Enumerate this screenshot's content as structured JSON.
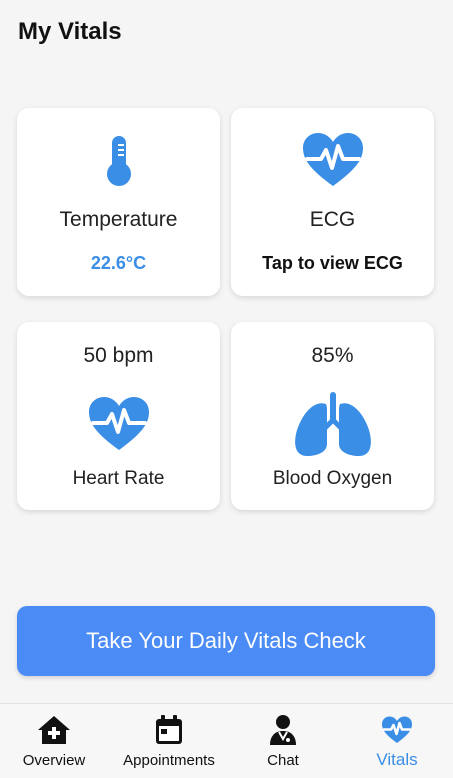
{
  "header": {
    "title": "My Vitals"
  },
  "cards": {
    "temperature": {
      "label": "Temperature",
      "value": "22.6°C",
      "icon": "thermometer-icon"
    },
    "ecg": {
      "label": "ECG",
      "value": "Tap to view ECG",
      "icon": "heart-pulse-icon"
    },
    "heart_rate": {
      "value": "50 bpm",
      "label": "Heart Rate",
      "icon": "heart-pulse-icon"
    },
    "blood_oxygen": {
      "value": "85%",
      "label": "Blood Oxygen",
      "icon": "lungs-icon"
    }
  },
  "cta": {
    "label": "Take Your Daily Vitals Check"
  },
  "nav": {
    "items": [
      {
        "label": "Overview",
        "icon": "home-plus-icon"
      },
      {
        "label": "Appointments",
        "icon": "calendar-icon"
      },
      {
        "label": "Chat",
        "icon": "doctor-icon"
      },
      {
        "label": "Vitals",
        "icon": "heart-pulse-icon",
        "active": true
      }
    ]
  },
  "colors": {
    "accent": "#4a8bf5",
    "icon_blue": "#3a8ee6",
    "background": "#f5f5f5",
    "card": "#ffffff"
  }
}
